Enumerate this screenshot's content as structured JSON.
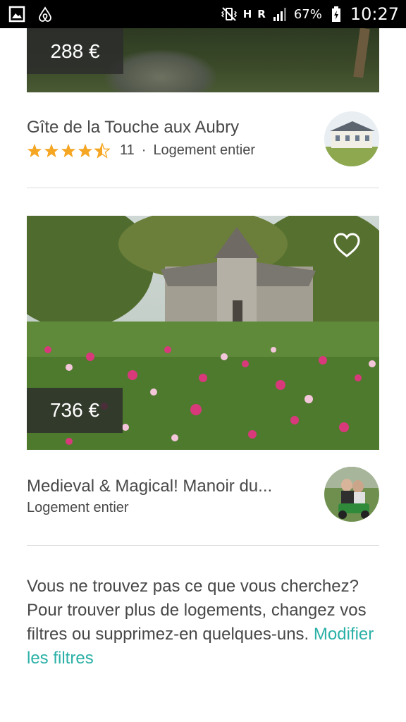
{
  "status_bar": {
    "battery_percent": "67%",
    "time": "10:27",
    "network_label": "H",
    "roaming_label": "R"
  },
  "listings": [
    {
      "price": "288 €",
      "title": "Gîte de la Touche aux Aubry",
      "rating": 4.5,
      "review_count": "11",
      "separator": "·",
      "type": "Logement entier"
    },
    {
      "price": "736 €",
      "title": "Medieval & Magical! Manoir du...",
      "type": "Logement entier"
    }
  ],
  "empty_note": {
    "text": "Vous ne trouvez pas ce que vous cherchez? Pour trouver plus de logements, changez vos filtres ou supprimez-en quelques-uns.",
    "link": "Modifier les filtres"
  },
  "colors": {
    "star": "#f5a623",
    "link": "#2ab0a6",
    "text": "#484848"
  }
}
